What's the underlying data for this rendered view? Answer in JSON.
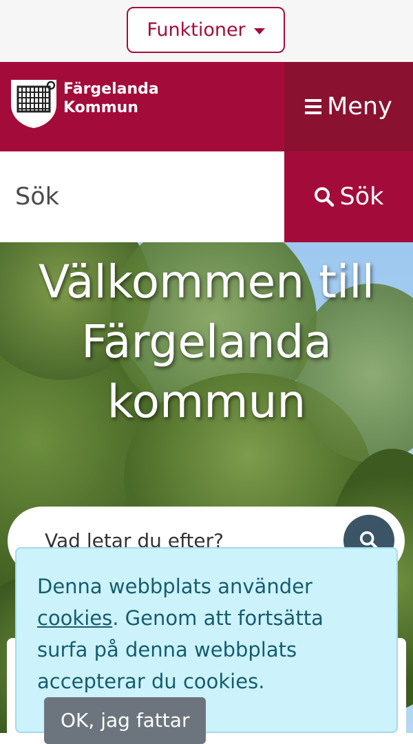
{
  "topbar": {
    "functions_label": "Funktioner"
  },
  "header": {
    "logo_line1": "Färgelanda",
    "logo_line2": "Kommun",
    "menu_label": "Meny"
  },
  "search": {
    "placeholder": "Sök",
    "button_label": "Sök"
  },
  "hero": {
    "title_line1": "Välkommen till",
    "title_line2": "Färgelanda",
    "title_line3": "kommun",
    "search_placeholder": "Vad letar du efter?"
  },
  "cookie": {
    "text_before": "Denna webbplats använder ",
    "link": "cookies",
    "text_after": ". Genom att fortsätta surfa på denna webbplats accepterar du cookies.",
    "ok_label": "OK, jag fattar"
  },
  "colors": {
    "brand": "#a30c3a",
    "brand_dark": "#8a1230",
    "cookie_bg": "#ccf2fb",
    "cookie_text": "#155d6e"
  },
  "icons": [
    "caret-down-icon",
    "coat-of-arms-logo",
    "hamburger-icon",
    "search-icon"
  ]
}
